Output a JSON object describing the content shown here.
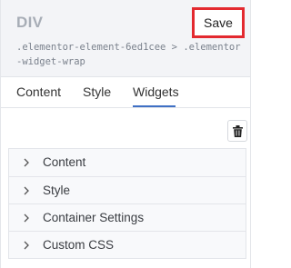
{
  "header": {
    "title": "DIV",
    "save_label": "Save",
    "selector": ".elementor-element-6ed1cee > .elementor-widget-wrap"
  },
  "tabs": [
    {
      "label": "Content",
      "active": false
    },
    {
      "label": "Style",
      "active": false
    },
    {
      "label": "Widgets",
      "active": true
    }
  ],
  "toolbar": {
    "delete_icon": "trash-icon"
  },
  "sections": [
    {
      "label": "Content",
      "icon": "chevron-right-icon"
    },
    {
      "label": "Style",
      "icon": "chevron-right-icon"
    },
    {
      "label": "Container Settings",
      "icon": "chevron-right-icon"
    },
    {
      "label": "Custom CSS",
      "icon": "chevron-right-icon"
    }
  ],
  "colors": {
    "accent": "#3f70c4",
    "save_highlight": "#e3292f"
  }
}
